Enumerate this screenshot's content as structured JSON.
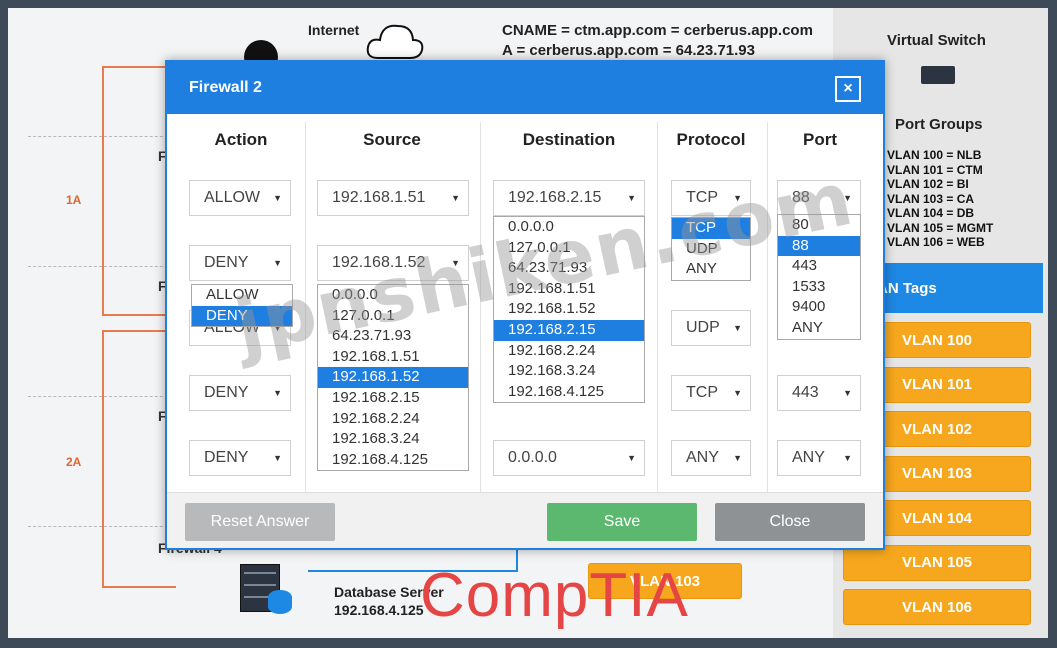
{
  "diagram": {
    "internet_label": "Internet",
    "dns_line1": "CNAME = ctm.app.com = cerberus.app.com",
    "dns_line2": "A = cerberus.app.com = 64.23.71.93",
    "zone_1a": "1A",
    "zone_2a": "2A",
    "fw_fragment": "F",
    "fw_fragment_bottom": "Firewall 4",
    "db_title": "Database Server",
    "db_ip": "192.168.4.125",
    "vlan_partial": "VLAN 103"
  },
  "right_panel": {
    "virtual_switch": "Virtual Switch",
    "port_groups_title": "Port Groups",
    "port_groups": [
      "VLAN 100 = NLB",
      "VLAN 101 = CTM",
      "VLAN 102 = BI",
      "VLAN 103 = CA",
      "VLAN 104 = DB",
      "VLAN 105 = MGMT",
      "VLAN 106 = WEB"
    ],
    "tags_header": "AN Tags",
    "tags": [
      "VLAN 100",
      "VLAN 101",
      "VLAN 102",
      "VLAN 103",
      "VLAN 104",
      "VLAN 105",
      "VLAN 106"
    ]
  },
  "dialog": {
    "title": "Firewall 2",
    "close": "×",
    "headers": {
      "action": "Action",
      "source": "Source",
      "destination": "Destination",
      "protocol": "Protocol",
      "port": "Port"
    },
    "rows": [
      {
        "action": "ALLOW",
        "source": "192.168.1.51",
        "destination": "192.168.2.15",
        "protocol": "TCP",
        "port": "88"
      },
      {
        "action": "DENY",
        "source": "192.168.1.52",
        "destination": "",
        "protocol": "UDP",
        "port": ""
      },
      {
        "action": "DENY",
        "source": "",
        "destination": "",
        "protocol": "TCP",
        "port": "443"
      },
      {
        "action": "DENY",
        "source": "",
        "destination": "0.0.0.0",
        "protocol": "ANY",
        "port": "ANY"
      }
    ],
    "row2_action_under": "ALLOW",
    "action_dropdown": [
      "ALLOW",
      "DENY"
    ],
    "source_dropdown": [
      "0.0.0.0",
      "127.0.0.1",
      "64.23.71.93",
      "192.168.1.51",
      "192.168.1.52",
      "192.168.2.15",
      "192.168.2.24",
      "192.168.3.24",
      "192.168.4.125"
    ],
    "destination_dropdown": [
      "0.0.0.0",
      "127.0.0.1",
      "64.23.71.93",
      "192.168.1.51",
      "192.168.1.52",
      "192.168.2.15",
      "192.168.2.24",
      "192.168.3.24",
      "192.168.4.125"
    ],
    "protocol_dropdown": [
      "TCP",
      "UDP",
      "ANY"
    ],
    "port_dropdown": [
      "80",
      "88",
      "443",
      "1533",
      "9400",
      "ANY"
    ],
    "buttons": {
      "reset": "Reset Answer",
      "save": "Save",
      "close": "Close"
    }
  },
  "watermark": "jpnshiken.com",
  "brand": "CompTIA"
}
